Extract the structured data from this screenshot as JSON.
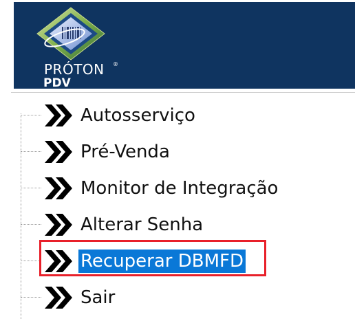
{
  "header": {
    "brand_name": "PRÓTON",
    "brand_reg": "®",
    "brand_sub": "PDV",
    "logo_icon": "barcode-diamond-logo-icon",
    "background": "#0f3460"
  },
  "menu": {
    "items": [
      {
        "label": "Autosserviço",
        "icon": "double-chevron-right-icon",
        "selected": false
      },
      {
        "label": "Pré-Venda",
        "icon": "double-chevron-right-icon",
        "selected": false
      },
      {
        "label": "Monitor de Integração",
        "icon": "double-chevron-right-icon",
        "selected": false
      },
      {
        "label": "Alterar Senha",
        "icon": "double-chevron-right-icon",
        "selected": false
      },
      {
        "label": "Recuperar DBMFD",
        "icon": "double-chevron-right-icon",
        "selected": true
      },
      {
        "label": "Sair",
        "icon": "double-chevron-right-icon",
        "selected": false
      }
    ],
    "selection_color": "#0a78d7",
    "highlight_color": "#e8202a"
  }
}
